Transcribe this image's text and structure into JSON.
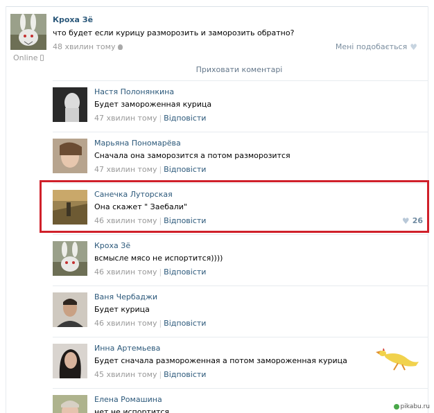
{
  "post": {
    "author": "Кроха Зё",
    "text": "что будет если курицу разморозить и заморозить обратно?",
    "time": "48 хвилин тому",
    "likes_label": "Мені подобається",
    "online_label": "Online"
  },
  "hide_comments_label": "Приховати коментарі",
  "reply_label": "Відповісти",
  "comments": [
    {
      "author": "Настя Полонянкина",
      "text": "Будет замороженная курица",
      "time": "47 хвилин тому"
    },
    {
      "author": "Марьяна Пономарёва",
      "text": "Сначала она заморозится а потом разморозится",
      "time": "47 хвилин тому"
    },
    {
      "author": "Санечка Луторская",
      "text": "Она скажет \" Заебали\"",
      "time": "46 хвилин тому",
      "likes": "26"
    },
    {
      "author": "Кроха Зё",
      "text": "всмысле мясо не испортится))))",
      "time": "46 хвилин тому"
    },
    {
      "author": "Ваня Чербаджи",
      "text": "Будет курица",
      "time": "46 хвилин тому"
    },
    {
      "author": "Инна Артемьева",
      "text": "Будет сначала размороженная а потом замороженная курица",
      "time": "45 хвилин тому"
    },
    {
      "author": "Елена Ромашина",
      "text": "нет не испортится",
      "time": ""
    }
  ],
  "watermark": "pikabu.ru",
  "colors": {
    "link": "#2b587a",
    "highlight": "#d0202a",
    "muted": "#999999"
  }
}
